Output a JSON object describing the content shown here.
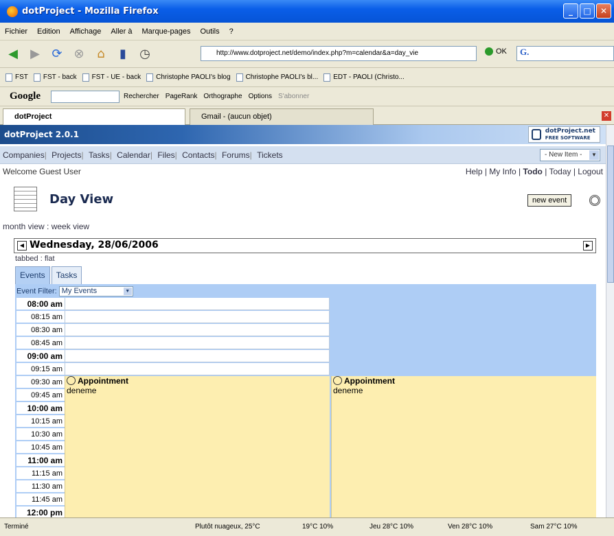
{
  "window": {
    "title": "dotProject - Mozilla Firefox"
  },
  "menu": [
    "Fichier",
    "Edition",
    "Affichage",
    "Aller à",
    "Marque-pages",
    "Outils",
    "?"
  ],
  "nav": {
    "url": "http://www.dotproject.net/demo/index.php?m=calendar&a=day_vie",
    "ok_label": "OK",
    "search_value": "G."
  },
  "bookmarks": [
    "FST",
    "FST - back",
    "FST - UE - back",
    "Christophe PAOLI's blog",
    "Christophe PAOLI's bl...",
    "EDT - PAOLI (Christo..."
  ],
  "google_toolbar": {
    "logo": "Google",
    "items": [
      "Rechercher",
      "PageRank",
      "Orthographe",
      "Options",
      "S'abonner"
    ]
  },
  "tabs": [
    {
      "label": "dotProject",
      "active": true
    },
    {
      "label": "Gmail - (aucun objet)",
      "active": false
    }
  ],
  "app": {
    "title": "dotProject 2.0.1",
    "logo_line1": "dotProject.net",
    "logo_line2": "FREE SOFTWARE",
    "menu": [
      "Companies",
      "Projects",
      "Tasks",
      "Calendar",
      "Files",
      "Contacts",
      "Forums",
      "Tickets"
    ],
    "new_item": "- New Item -",
    "welcome": "Welcome Guest User",
    "links": [
      "Help",
      "My Info",
      "Todo",
      "Today",
      "Logout"
    ]
  },
  "page": {
    "title": "Day View",
    "new_event": "new event",
    "views": [
      "month view",
      "week view"
    ],
    "date": "Wednesday, 28/06/2006",
    "layout_links": [
      "tabbed",
      "flat"
    ],
    "subtabs": [
      "Events",
      "Tasks"
    ],
    "filter_label": "Event Filter:",
    "filter_value": "My Events"
  },
  "timeslots": [
    "08:00 am",
    "08:15 am",
    "08:30 am",
    "08:45 am",
    "09:00 am",
    "09:15 am",
    "09:30 am",
    "09:45 am",
    "10:00 am",
    "10:15 am",
    "10:30 am",
    "10:45 am",
    "11:00 am",
    "11:15 am",
    "11:30 am",
    "11:45 am",
    "12:00 pm"
  ],
  "events": [
    {
      "title": "Appointment",
      "desc": "deneme"
    },
    {
      "title": "Appointment",
      "desc": "deneme"
    }
  ],
  "status": {
    "left": "Terminé",
    "weather": [
      "Plutôt nuageux, 25°C",
      "19°C 10%",
      "Jeu 28°C 10%",
      "Ven 28°C 10%",
      "Sam 27°C 10%"
    ]
  },
  "colors": {
    "header_blue": "#2e66b0",
    "calendar_bg": "#aecdf5",
    "event_bg": "#fdeeb0"
  }
}
